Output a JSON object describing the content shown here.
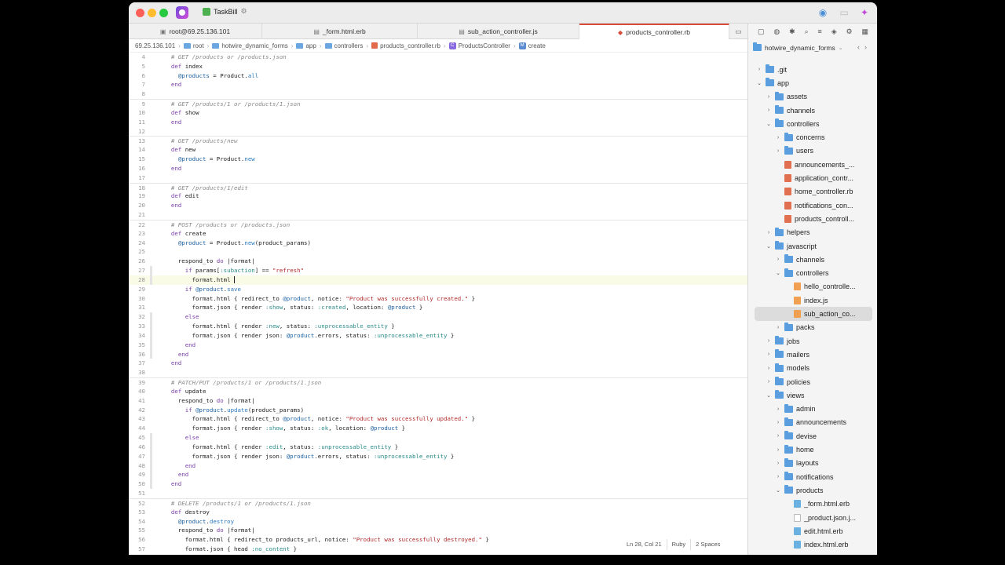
{
  "titlebar": {
    "app_title": "TaskBill"
  },
  "tabs": [
    {
      "label": "root@69.25.136.101",
      "active": false
    },
    {
      "label": "_form.html.erb",
      "active": false
    },
    {
      "label": "sub_action_controller.js",
      "active": false
    },
    {
      "label": "products_controller.rb",
      "active": true
    }
  ],
  "breadcrumb": [
    "69.25.136.101",
    "root",
    "hotwire_dynamic_forms",
    "app",
    "controllers",
    "products_controller.rb",
    "ProductsController",
    "create"
  ],
  "editor": {
    "lines": [
      {
        "n": "4",
        "code": "  # GET /products or /products.json"
      },
      {
        "n": "5",
        "code": "  def index"
      },
      {
        "n": "6",
        "code": "    @products = Product.all"
      },
      {
        "n": "7",
        "code": "  end"
      },
      {
        "n": "8",
        "code": ""
      },
      {
        "n": "9",
        "code": "  # GET /products/1 or /products/1.json"
      },
      {
        "n": "10",
        "code": "  def show"
      },
      {
        "n": "11",
        "code": "  end"
      },
      {
        "n": "12",
        "code": ""
      },
      {
        "n": "13",
        "code": "  # GET /products/new"
      },
      {
        "n": "14",
        "code": "  def new"
      },
      {
        "n": "15",
        "code": "    @product = Product.new"
      },
      {
        "n": "16",
        "code": "  end"
      },
      {
        "n": "17",
        "code": ""
      },
      {
        "n": "18",
        "code": "  # GET /products/1/edit"
      },
      {
        "n": "19",
        "code": "  def edit"
      },
      {
        "n": "20",
        "code": "  end"
      },
      {
        "n": "21",
        "code": ""
      },
      {
        "n": "22",
        "code": "  # POST /products or /products.json"
      },
      {
        "n": "23",
        "code": "  def create"
      },
      {
        "n": "24",
        "code": "    @product = Product.new(product_params)"
      },
      {
        "n": "25",
        "code": ""
      },
      {
        "n": "26",
        "code": "    respond_to do |format|"
      },
      {
        "n": "27",
        "code": "      if params[:subaction] == \"refresh\""
      },
      {
        "n": "28",
        "code": "        format.html "
      },
      {
        "n": "29",
        "code": "      if @product.save"
      },
      {
        "n": "30",
        "code": "        format.html { redirect_to @product, notice: \"Product was successfully created.\" }"
      },
      {
        "n": "31",
        "code": "        format.json { render :show, status: :created, location: @product }"
      },
      {
        "n": "32",
        "code": "      else"
      },
      {
        "n": "33",
        "code": "        format.html { render :new, status: :unprocessable_entity }"
      },
      {
        "n": "34",
        "code": "        format.json { render json: @product.errors, status: :unprocessable_entity }"
      },
      {
        "n": "35",
        "code": "      end"
      },
      {
        "n": "36",
        "code": "    end"
      },
      {
        "n": "37",
        "code": "  end"
      },
      {
        "n": "38",
        "code": ""
      },
      {
        "n": "39",
        "code": "  # PATCH/PUT /products/1 or /products/1.json"
      },
      {
        "n": "40",
        "code": "  def update"
      },
      {
        "n": "41",
        "code": "    respond_to do |format|"
      },
      {
        "n": "42",
        "code": "      if @product.update(product_params)"
      },
      {
        "n": "43",
        "code": "        format.html { redirect_to @product, notice: \"Product was successfully updated.\" }"
      },
      {
        "n": "44",
        "code": "        format.json { render :show, status: :ok, location: @product }"
      },
      {
        "n": "45",
        "code": "      else"
      },
      {
        "n": "46",
        "code": "        format.html { render :edit, status: :unprocessable_entity }"
      },
      {
        "n": "47",
        "code": "        format.json { render json: @product.errors, status: :unprocessable_entity }"
      },
      {
        "n": "48",
        "code": "      end"
      },
      {
        "n": "49",
        "code": "    end"
      },
      {
        "n": "50",
        "code": "  end"
      },
      {
        "n": "51",
        "code": ""
      },
      {
        "n": "52",
        "code": "  # DELETE /products/1 or /products/1.json"
      },
      {
        "n": "53",
        "code": "  def destroy"
      },
      {
        "n": "54",
        "code": "    @product.destroy"
      },
      {
        "n": "55",
        "code": "    respond_to do |format|"
      },
      {
        "n": "56",
        "code": "      format.html { redirect_to products_url, notice: \"Product was successfully destroyed.\" }"
      },
      {
        "n": "57",
        "code": "      format.json { head :no_content }"
      }
    ]
  },
  "statusbar": {
    "position": "Ln 28, Col 21",
    "language": "Ruby",
    "indent": "2 Spaces"
  },
  "sidebar": {
    "project": "hotwire_dynamic_forms",
    "tree": [
      {
        "label": ".git",
        "kind": "folder",
        "depth": 0,
        "chev": "right"
      },
      {
        "label": "app",
        "kind": "folder",
        "depth": 0,
        "chev": "down"
      },
      {
        "label": "assets",
        "kind": "folder",
        "depth": 1,
        "chev": "right"
      },
      {
        "label": "channels",
        "kind": "folder",
        "depth": 1,
        "chev": "right"
      },
      {
        "label": "controllers",
        "kind": "folder",
        "depth": 1,
        "chev": "down"
      },
      {
        "label": "concerns",
        "kind": "folder",
        "depth": 2,
        "chev": "right"
      },
      {
        "label": "users",
        "kind": "folder",
        "depth": 2,
        "chev": "right"
      },
      {
        "label": "announcements_...",
        "kind": "rb",
        "depth": 2,
        "chev": ""
      },
      {
        "label": "application_contr...",
        "kind": "rb",
        "depth": 2,
        "chev": ""
      },
      {
        "label": "home_controller.rb",
        "kind": "rb",
        "depth": 2,
        "chev": ""
      },
      {
        "label": "notifications_con...",
        "kind": "rb",
        "depth": 2,
        "chev": ""
      },
      {
        "label": "products_controll...",
        "kind": "rb",
        "depth": 2,
        "chev": ""
      },
      {
        "label": "helpers",
        "kind": "folder",
        "depth": 1,
        "chev": "right"
      },
      {
        "label": "javascript",
        "kind": "folder",
        "depth": 1,
        "chev": "down"
      },
      {
        "label": "channels",
        "kind": "folder",
        "depth": 2,
        "chev": "right"
      },
      {
        "label": "controllers",
        "kind": "folder",
        "depth": 2,
        "chev": "down"
      },
      {
        "label": "hello_controlle...",
        "kind": "js",
        "depth": 3,
        "chev": ""
      },
      {
        "label": "index.js",
        "kind": "js",
        "depth": 3,
        "chev": ""
      },
      {
        "label": "sub_action_co...",
        "kind": "js",
        "depth": 3,
        "chev": "",
        "selected": true
      },
      {
        "label": "packs",
        "kind": "folder",
        "depth": 2,
        "chev": "right"
      },
      {
        "label": "jobs",
        "kind": "folder",
        "depth": 1,
        "chev": "right"
      },
      {
        "label": "mailers",
        "kind": "folder",
        "depth": 1,
        "chev": "right"
      },
      {
        "label": "models",
        "kind": "folder",
        "depth": 1,
        "chev": "right"
      },
      {
        "label": "policies",
        "kind": "folder",
        "depth": 1,
        "chev": "right"
      },
      {
        "label": "views",
        "kind": "folder",
        "depth": 1,
        "chev": "down"
      },
      {
        "label": "admin",
        "kind": "folder",
        "depth": 2,
        "chev": "right"
      },
      {
        "label": "announcements",
        "kind": "folder",
        "depth": 2,
        "chev": "right"
      },
      {
        "label": "devise",
        "kind": "folder",
        "depth": 2,
        "chev": "right"
      },
      {
        "label": "home",
        "kind": "folder",
        "depth": 2,
        "chev": "right"
      },
      {
        "label": "layouts",
        "kind": "folder",
        "depth": 2,
        "chev": "right"
      },
      {
        "label": "notifications",
        "kind": "folder",
        "depth": 2,
        "chev": "right"
      },
      {
        "label": "products",
        "kind": "folder",
        "depth": 2,
        "chev": "down"
      },
      {
        "label": "_form.html.erb",
        "kind": "erb",
        "depth": 3,
        "chev": ""
      },
      {
        "label": "_product.json.j...",
        "kind": "file",
        "depth": 3,
        "chev": ""
      },
      {
        "label": "edit.html.erb",
        "kind": "erb",
        "depth": 3,
        "chev": ""
      },
      {
        "label": "index.html.erb",
        "kind": "erb",
        "depth": 3,
        "chev": ""
      }
    ]
  }
}
